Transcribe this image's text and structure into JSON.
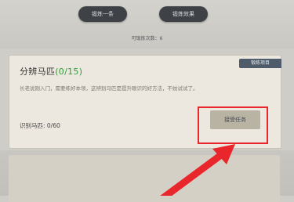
{
  "header": {
    "button1_label": "锻炼一条",
    "button2_label": "锻炼效果",
    "remaining_label": "可锻炼次数：6"
  },
  "task_card": {
    "tag_label": "锻炼项目",
    "title": "分辨马匹",
    "progress": "(0/15)",
    "description": "长老说刚入门，需要练好本领，这辨别马匹是提升眼识的好方法，不妨试试了。",
    "count_label": "识别马匹: 0/60",
    "accept_label": "接受任务"
  },
  "annotation": {
    "highlight_color": "#e8262b",
    "arrow_color": "#e8262b"
  }
}
